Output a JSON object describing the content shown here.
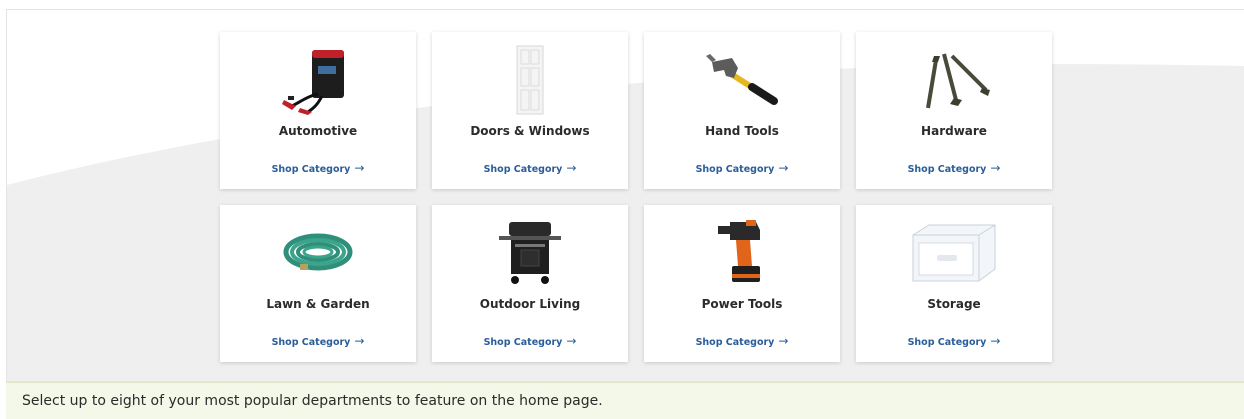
{
  "categories": [
    {
      "title": "Automotive",
      "link": "Shop Category",
      "icon": "jump-starter-icon"
    },
    {
      "title": "Doors & Windows",
      "link": "Shop Category",
      "icon": "door-icon"
    },
    {
      "title": "Hand Tools",
      "link": "Shop Category",
      "icon": "hammer-icon"
    },
    {
      "title": "Hardware",
      "link": "Shop Category",
      "icon": "screws-icon"
    },
    {
      "title": "Lawn & Garden",
      "link": "Shop Category",
      "icon": "garden-hose-icon"
    },
    {
      "title": "Outdoor Living",
      "link": "Shop Category",
      "icon": "grill-icon"
    },
    {
      "title": "Power Tools",
      "link": "Shop Category",
      "icon": "power-drill-icon"
    },
    {
      "title": "Storage",
      "link": "Shop Category",
      "icon": "storage-bin-icon"
    }
  ],
  "footer": {
    "text": "Select up to eight of your most popular departments to feature on the home page."
  },
  "colors": {
    "link": "#2a5d9a",
    "footer_bg": "#f3f8e8",
    "swoosh": "#efefef"
  }
}
